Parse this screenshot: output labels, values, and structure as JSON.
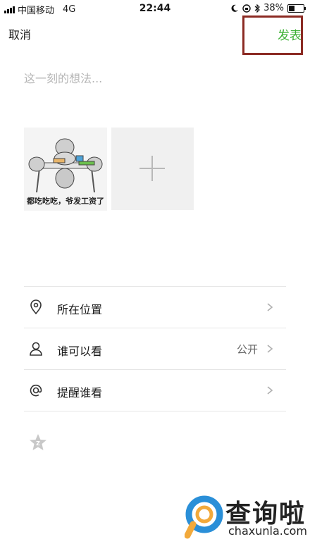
{
  "status_bar": {
    "carrier": "中国移动",
    "network": "4G",
    "time": "22:44",
    "battery": "38%",
    "battery_level": 0.38
  },
  "nav": {
    "cancel_label": "取消",
    "publish_label": "发表",
    "publish_color": "#3cb034"
  },
  "compose": {
    "placeholder": "这一刻的想法..."
  },
  "photos": [
    {
      "caption": "都吃吃吃，爷发工资了"
    }
  ],
  "options": [
    {
      "label": "所在位置",
      "value": "",
      "icon": "location-pin-icon"
    },
    {
      "label": "谁可以看",
      "value": "公开",
      "icon": "person-icon"
    },
    {
      "label": "提醒谁看",
      "value": "",
      "icon": "at-sign-icon"
    }
  ],
  "watermark": {
    "title": "查询啦",
    "url": "chaxunla.com"
  }
}
